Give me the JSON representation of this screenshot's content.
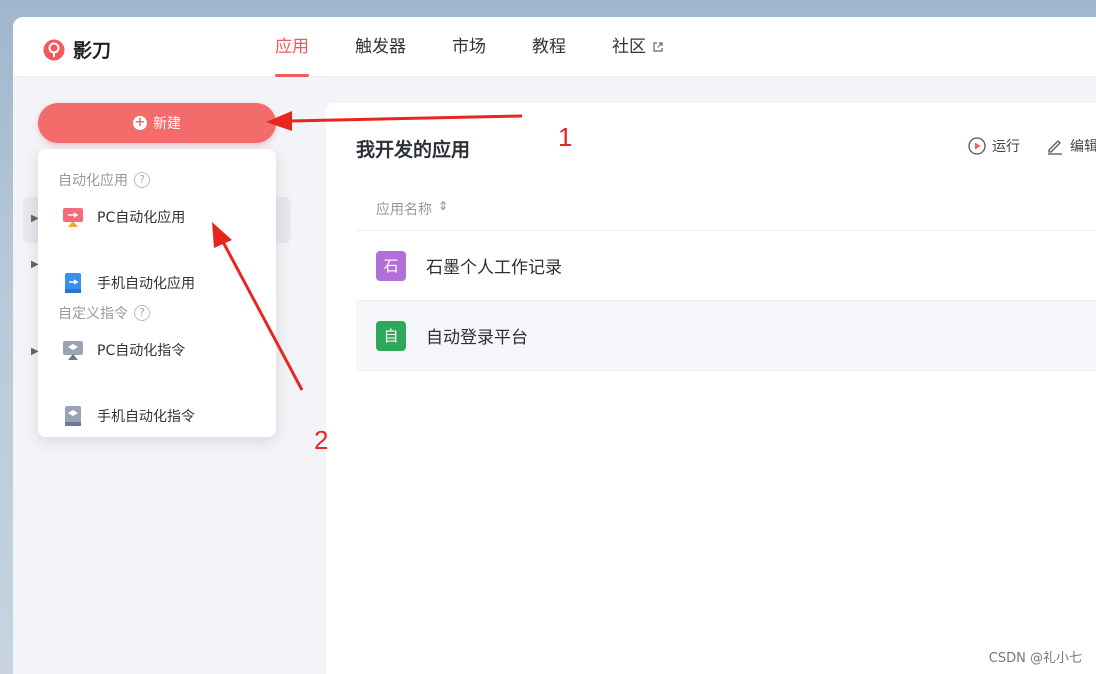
{
  "app": {
    "name": "影刀"
  },
  "nav": [
    {
      "label": "应用",
      "active": true
    },
    {
      "label": "触发器",
      "active": false
    },
    {
      "label": "市场",
      "active": false
    },
    {
      "label": "教程",
      "active": false
    },
    {
      "label": "社区",
      "active": false,
      "external": true
    }
  ],
  "new_button": {
    "label": "新建"
  },
  "dropdown": {
    "sections": [
      {
        "title": "自动化应用",
        "items": [
          {
            "label": "PC自动化应用",
            "icon": "pc-automation-app-icon"
          },
          {
            "label": "手机自动化应用",
            "icon": "mobile-automation-app-icon"
          }
        ]
      },
      {
        "title": "自定义指令",
        "items": [
          {
            "label": "PC自动化指令",
            "icon": "pc-automation-command-icon"
          },
          {
            "label": "手机自动化指令",
            "icon": "mobile-automation-command-icon"
          }
        ]
      }
    ]
  },
  "main": {
    "title": "我开发的应用",
    "toolbar": {
      "run_label": "运行",
      "edit_label": "编辑"
    },
    "column_header": "应用名称",
    "apps": [
      {
        "avatar": "石",
        "name": "石墨个人工作记录",
        "color": "#b36fd8"
      },
      {
        "avatar": "自",
        "name": "自动登录平台",
        "color": "#2ea85a"
      }
    ]
  },
  "annotations": {
    "marker_1": "1",
    "marker_2": "2"
  },
  "watermark": "CSDN @礼小七",
  "colors": {
    "accent": "#f05a5a",
    "button": "#f46b6b",
    "annotation": "#e8261f"
  }
}
